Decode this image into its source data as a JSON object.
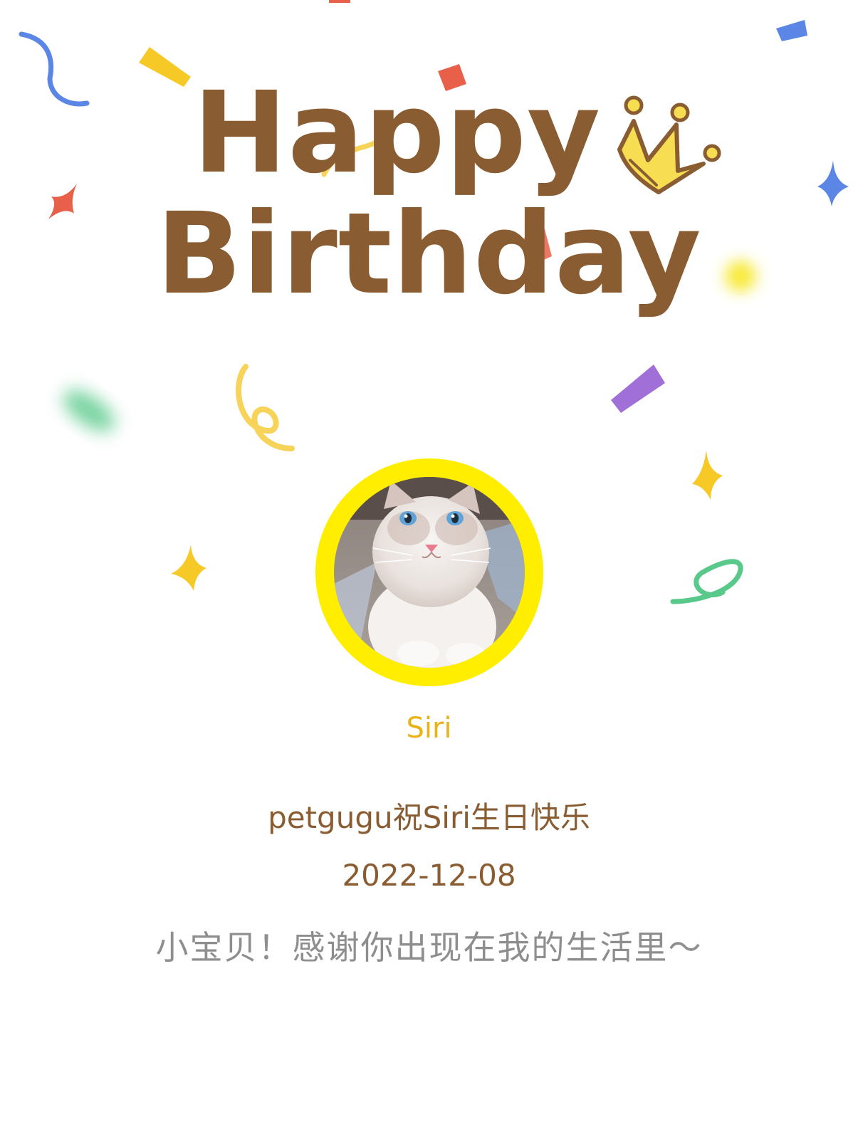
{
  "card": {
    "title_line1": "Happy",
    "title_line2": "Birthday",
    "pet_name": "Siri",
    "greeting": "petgugu祝Siri生日快乐",
    "date": "2022-12-08",
    "message": "小宝贝！感谢你出现在我的生活里～"
  },
  "icons": {
    "crown": "crown-icon",
    "avatar": "cat-avatar"
  },
  "colors": {
    "background": "#ffffff",
    "title": "#8a5c32",
    "pet_name": "#e9b216",
    "greeting": "#8a5c32",
    "message": "#8e8e8e",
    "avatar_ring": "#ffee00",
    "confetti_blue": "#5b86e5",
    "confetti_yellow": "#f7c926",
    "confetti_red": "#e8604a",
    "confetti_purple": "#a070d8",
    "confetti_green": "#58c98a"
  }
}
